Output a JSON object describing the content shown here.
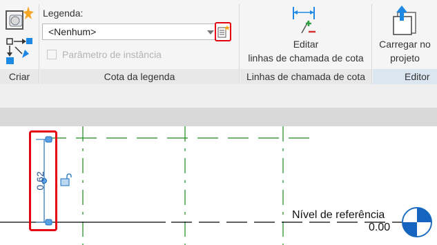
{
  "ribbon": {
    "legend_label": "Legenda:",
    "legend_select_value": "<Nenhum>",
    "instance_param_label": "Parâmetro de instância",
    "instance_param_checked": false,
    "instance_param_enabled": false,
    "edit_callouts_line1": "Editar",
    "edit_callouts_line2": "linhas de chamada de cota",
    "load_project_line1": "Carregar no",
    "load_project_line2": "projeto",
    "panels": {
      "create": "Criar",
      "dimension_legend": "Cota da legenda",
      "callout_lines": "Linhas de chamada de cota",
      "editor": "Editor d"
    }
  },
  "canvas": {
    "dimension_value": "0.62",
    "level_name": "Nível de referência",
    "level_value": "0.00"
  },
  "colors": {
    "highlight": "#e3000f",
    "ribbon_bg": "#f5f5f5",
    "panel_label_bg": "#e8e8e8",
    "editor_panel_bg": "#dce6f0",
    "grid_line": "#1a8a1a",
    "level_line": "#000000",
    "dim_grip": "#5aa0e0"
  },
  "icons": {
    "create": "create-family-icon",
    "component": "component-arrows-icon",
    "legend_params": "legend-parameters-icon",
    "edit_callouts": "edit-callout-lines-icon",
    "load_project": "load-into-project-icon",
    "level_head": "level-head-icon",
    "lock": "dimension-lock-icon"
  }
}
